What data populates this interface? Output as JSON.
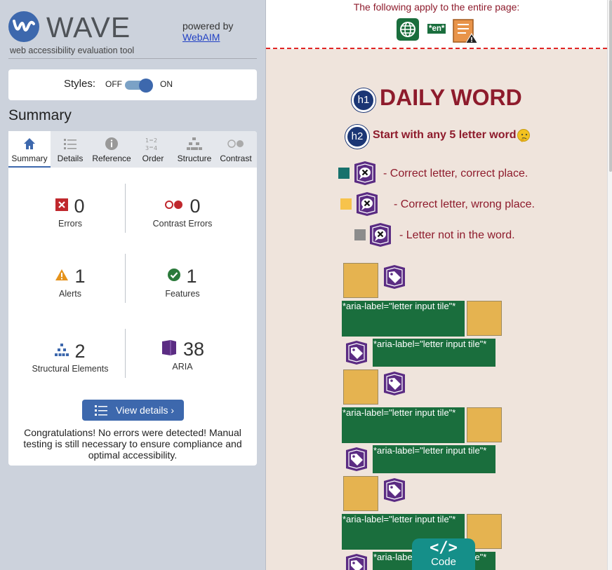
{
  "sidebar": {
    "title": "WAVE",
    "subtitle": "web accessibility evaluation tool",
    "powered_by": "powered by",
    "powered_link": "WebAIM",
    "styles_label": "Styles:",
    "styles_off": "OFF",
    "styles_on": "ON",
    "summary_heading": "Summary",
    "tabs": [
      {
        "label": "Summary",
        "icon": "home-icon",
        "active": true
      },
      {
        "label": "Details",
        "icon": "list-icon"
      },
      {
        "label": "Reference",
        "icon": "info-icon"
      },
      {
        "label": "Order",
        "icon": "order-icon"
      },
      {
        "label": "Structure",
        "icon": "structure-icon"
      },
      {
        "label": "Contrast",
        "icon": "contrast-icon"
      }
    ],
    "stats": {
      "errors": {
        "count": "0",
        "label": "Errors"
      },
      "contrast": {
        "count": "0",
        "label": "Contrast Errors"
      },
      "alerts": {
        "count": "1",
        "label": "Alerts"
      },
      "features": {
        "count": "1",
        "label": "Features"
      },
      "structural": {
        "count": "2",
        "label": "Structural Elements"
      },
      "aria": {
        "count": "38",
        "label": "ARIA"
      }
    },
    "view_details": "View details ›",
    "congrats": "Congratulations! No errors were detected! Manual testing is still necessary to ensure compliance and optimal accessibility."
  },
  "content": {
    "page_notice": "The following apply to the entire page:",
    "lang_badge": "*en*",
    "h1_badge": "h1",
    "h1_text": "DAILY WORD",
    "h2_badge": "h2",
    "h2_text": "Start with any 5 letter word",
    "legend": [
      {
        "text": "- Correct letter, correct place.",
        "color": "#17716c"
      },
      {
        "text": "- Correct letter, wrong place.",
        "color": "#f7c34c"
      },
      {
        "text": "- Letter not in the word.",
        "color": "#8c8c8c"
      }
    ],
    "aria_label": "*aria-label=\"letter input tile\"*",
    "code_label": "Code",
    "code_icon": "</>"
  },
  "colors": {
    "accent": "#3d68ad",
    "heading": "#8e1b2c",
    "aria_green": "#1a6e3d",
    "aria_purple": "#5b2c83",
    "code_tab": "#158f89"
  }
}
